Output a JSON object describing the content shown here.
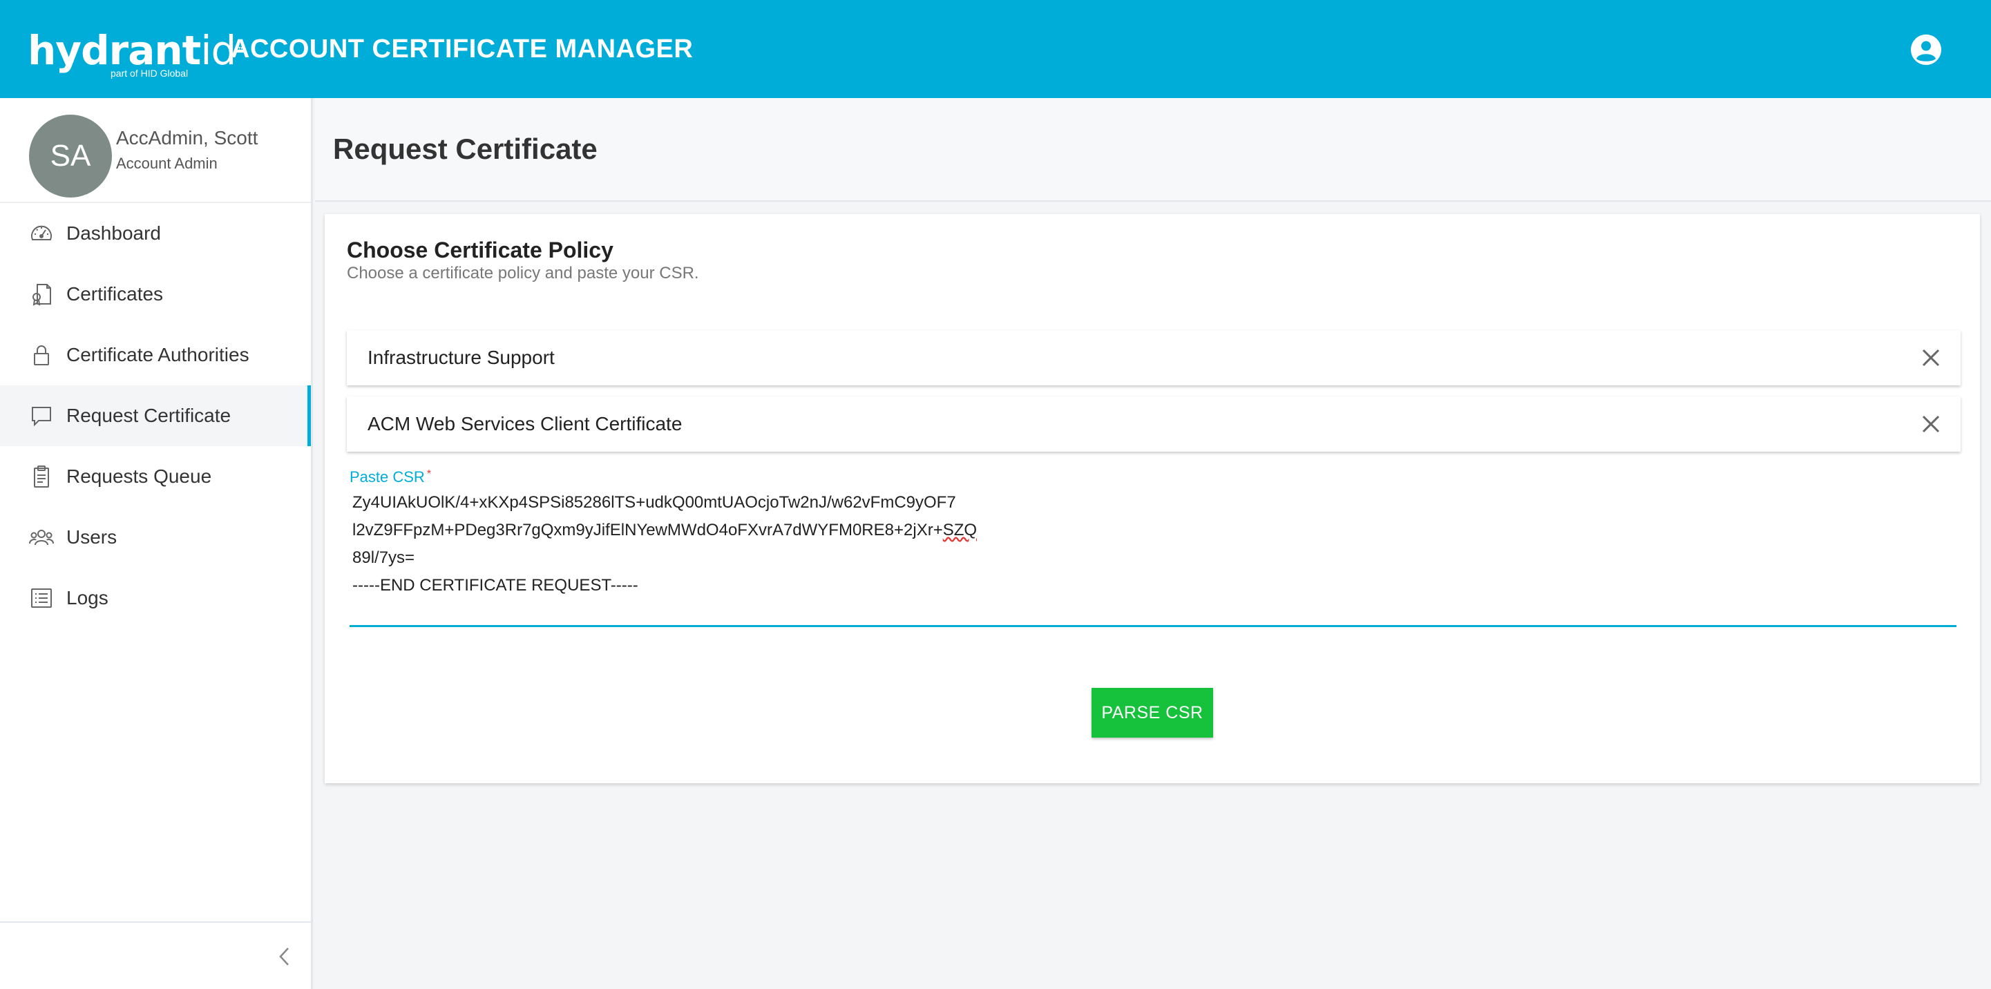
{
  "header": {
    "logo_primary": "hydrant",
    "logo_secondary": "id",
    "logo_trademark": "™",
    "logo_tagline": "part of HID Global",
    "app_title": "ACCOUNT CERTIFICATE MANAGER",
    "account_icon": "account-circle-icon"
  },
  "sidebar": {
    "profile": {
      "initials": "SA",
      "name": "AccAdmin, Scott",
      "role": "Account Admin"
    },
    "items": [
      {
        "label": "Dashboard",
        "icon": "dashboard-gauge-icon",
        "active": false
      },
      {
        "label": "Certificates",
        "icon": "certificate-document-icon",
        "active": false
      },
      {
        "label": "Certificate Authorities",
        "icon": "lock-icon",
        "active": false
      },
      {
        "label": "Request Certificate",
        "icon": "comment-icon",
        "active": true
      },
      {
        "label": "Requests Queue",
        "icon": "clipboard-icon",
        "active": false
      },
      {
        "label": "Users",
        "icon": "users-icon",
        "active": false
      },
      {
        "label": "Logs",
        "icon": "list-icon",
        "active": false
      }
    ],
    "collapse_icon": "chevron-left-icon"
  },
  "page": {
    "title": "Request Certificate"
  },
  "policy_card": {
    "title": "Choose Certificate Policy",
    "subtitle": "Choose a certificate policy and paste your CSR.",
    "selections": [
      {
        "label": "Infrastructure Support"
      },
      {
        "label": "ACM Web Services Client Certificate"
      }
    ],
    "csr": {
      "label": "Paste CSR",
      "required_marker": "*",
      "lines": [
        "Zy4UIAkUOlK/4+xKXp4SPSi85286lTS+udkQ00mtUAOcjoTw2nJ/w62vFmC9yOF7",
        "l2vZ9FFpzM+PDeg3Rr7gQxm9yJifElNYewMWdO4oFXvrA7dWYFM0RE8+2jXr+",
        "SZQ",
        "89l/7ys=",
        "-----END CERTIFICATE REQUEST-----"
      ]
    },
    "parse_button": "PARSE CSR"
  },
  "colors": {
    "brand": "#00acd8",
    "button": "#16c23c",
    "avatar": "#7e8b86"
  }
}
